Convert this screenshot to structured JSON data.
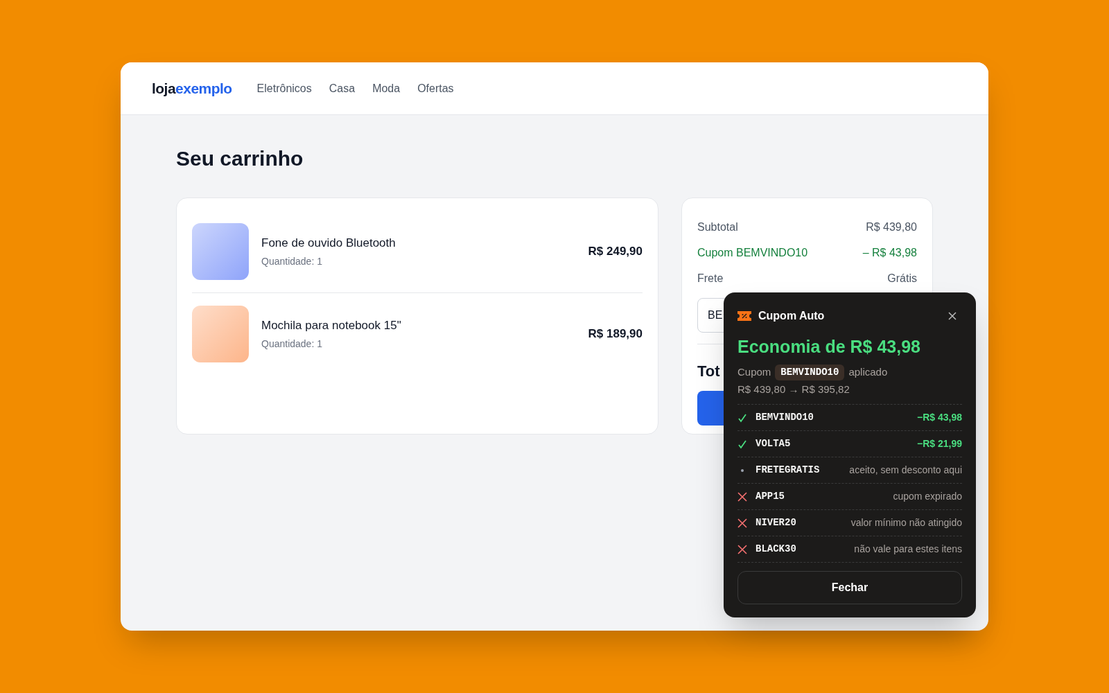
{
  "header": {
    "logo": {
      "part_1": "loja",
      "part_2": "exemplo"
    },
    "nav": [
      "Eletrônicos",
      "Casa",
      "Moda",
      "Ofertas"
    ]
  },
  "page_title": "Seu carrinho",
  "cart_items": [
    {
      "name": "Fone de ouvido Bluetooth",
      "quantity": "Quantidade: 1",
      "price": "R$ 249,90",
      "color": "#8fa4fa"
    },
    {
      "name": "Mochila para notebook 15\"",
      "quantity": "Quantidade: 1",
      "price": "R$ 189,90",
      "color": "#fdb58a"
    }
  ],
  "summary": {
    "rows": [
      {
        "label": "Subtotal",
        "value": "R$ 439,80",
        "kind": "plain"
      },
      {
        "label": "Cupom BEMVINDO10",
        "value": "– R$ 43,98",
        "kind": "discount"
      },
      {
        "label": "Frete",
        "value": "Grátis",
        "kind": "plain"
      }
    ],
    "coupon_field": {
      "value": "BE"
    },
    "total_label": "Tot"
  },
  "popup": {
    "title": "Cupom Auto",
    "savings": "Economia de R$ 43,98",
    "applied_prefix": "Cupom",
    "applied_code": "BEMVINDO10",
    "applied_suffix": "aplicado",
    "price_change": "R$ 439,80 → R$ 395,82",
    "coupons": [
      {
        "kind": "success",
        "code": "BEMVINDO10",
        "result": "−R$ 43,98"
      },
      {
        "kind": "success",
        "code": "VOLTA5",
        "result": "−R$ 21,99"
      },
      {
        "kind": "neutral",
        "code": "FRETEGRATIS",
        "result": "aceito, sem desconto aqui"
      },
      {
        "kind": "failed",
        "code": "APP15",
        "result": "cupom expirado"
      },
      {
        "kind": "failed",
        "code": "NIVER20",
        "result": "valor mínimo não atingido"
      },
      {
        "kind": "failed",
        "code": "BLACK30",
        "result": "não vale para estes itens"
      }
    ],
    "close_button": "Fechar"
  }
}
